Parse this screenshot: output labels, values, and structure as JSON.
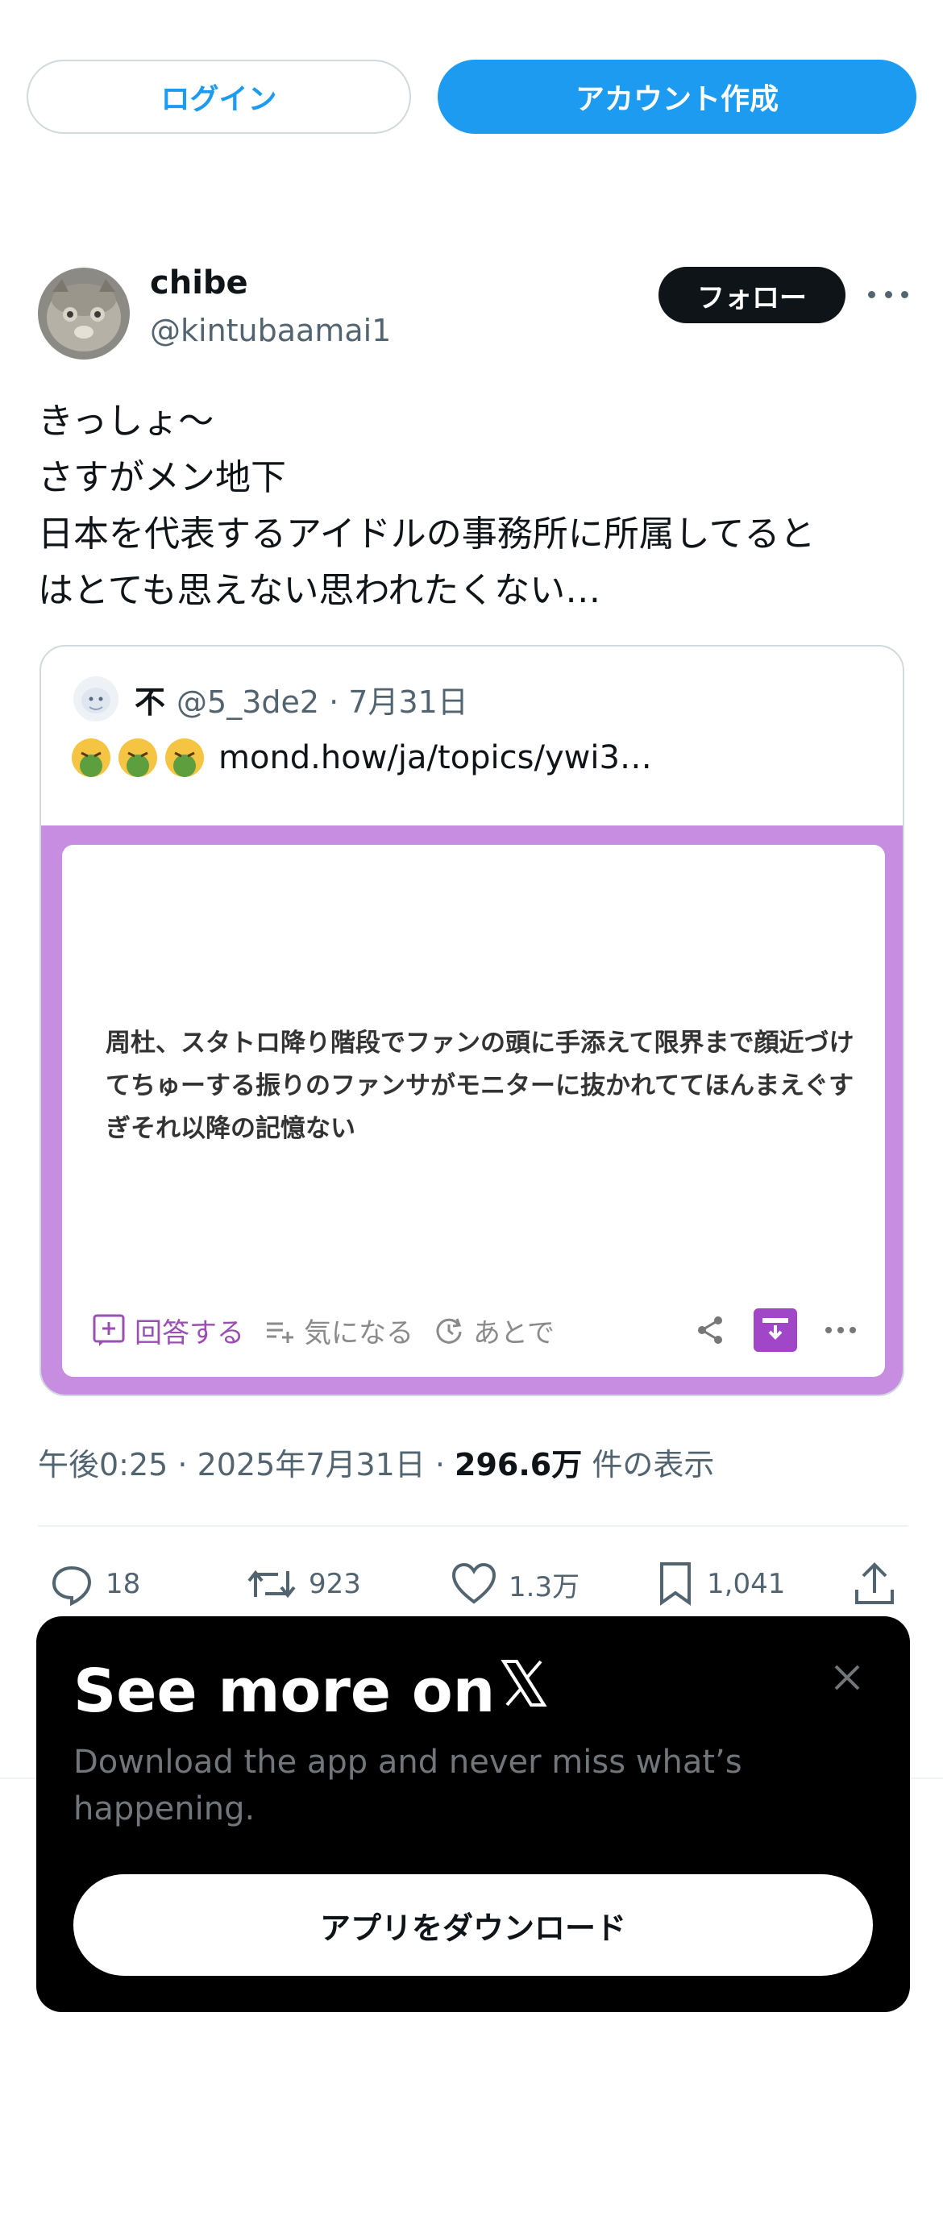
{
  "topbar": {
    "login_label": "ログイン",
    "signup_label": "アカウント作成"
  },
  "author": {
    "name": "chibe",
    "handle": "@kintubaamai1",
    "follow_label": "フォロー"
  },
  "tweet": {
    "text": "きっしょ〜\nさすがメン地下\n日本を代表するアイドルの事務所に所属してると\nはとても思えない思われたくない…"
  },
  "quote": {
    "name": "不",
    "meta": "@5_3de2 · 7月31日",
    "link_text": "mond.how/ja/topics/ywi3…",
    "card_text": "周杜、スタトロ降り階段でファンの頭に手添えて限界まで顔近づけてちゅーする振りのファンサがモニターに抜かれててほんまえぐすぎそれ以降の記憶ない",
    "answer_label": "回答する",
    "interested_label": "気になる",
    "later_label": "あとで",
    "accent_color": "#c78de0"
  },
  "timestamp": {
    "time": "午後0:25 · 2025年7月31日 · ",
    "views": "296.6万",
    "views_suffix": " 件の表示"
  },
  "metrics": {
    "replies": "18",
    "reposts": "923",
    "likes": "1.3万",
    "bookmarks": "1,041"
  },
  "overlay": {
    "title": "See more on",
    "subtitle": "Download the app and never miss what’s happening.",
    "button_label": "アプリをダウンロード"
  },
  "colors": {
    "brand": "#1d9bf0",
    "text": "#0f1419",
    "muted": "#536471"
  }
}
